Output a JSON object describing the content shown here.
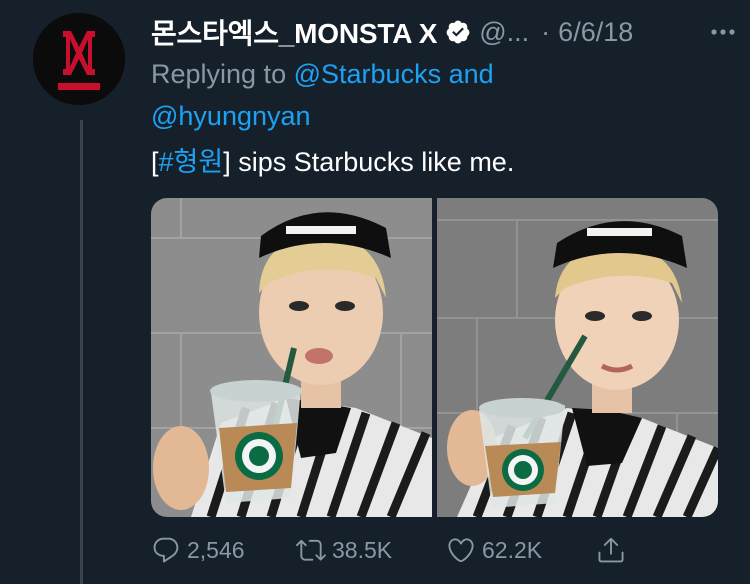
{
  "author": {
    "display_name": "몬스타엑스_MONSTA X",
    "handle": "@...",
    "separator": "·",
    "date": "6/6/18",
    "verified": true,
    "avatar_logo_text": "MONSTA X"
  },
  "reply": {
    "prefix": "Replying to",
    "mention_1": "@Starbucks and",
    "mention_2": "@hyungnyan"
  },
  "text": {
    "bracket_open": "[",
    "hashtag": "#형원",
    "bracket_close": "]",
    "body": " sips Starbucks like me."
  },
  "actions": {
    "reply_count": "2,546",
    "retweet_count": "38.5K",
    "like_count": "62.2K"
  },
  "icons": [
    "verified-badge-icon",
    "more-icon",
    "reply-icon",
    "retweet-icon",
    "like-icon",
    "share-icon"
  ],
  "colors": {
    "background": "#15202b",
    "link": "#1da1f2",
    "secondary_text": "#8899a6",
    "thread_line": "#38444d"
  }
}
